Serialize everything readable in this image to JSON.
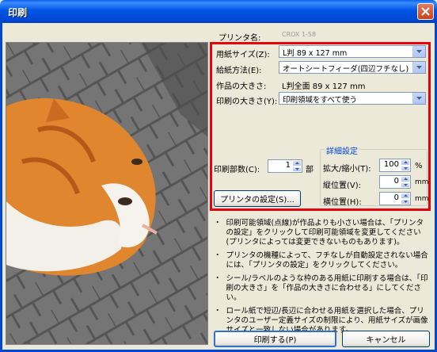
{
  "window": {
    "title": "印刷"
  },
  "printer": {
    "label": "プリンタ名:",
    "value": "CROX 1-58"
  },
  "paper_size": {
    "label": "用紙サイズ(Z):",
    "value": "L判 89 x 127 mm"
  },
  "feed_method": {
    "label": "給紙方法(E):",
    "value": "オートシートフィーダ(四辺フチなし)"
  },
  "work_size": {
    "label": "作品の大きさ:",
    "value": "L判全面 89 x 127 mm"
  },
  "print_size": {
    "label": "印刷の大きさ(Y):",
    "value": "印刷領域をすべて使う"
  },
  "copies": {
    "label": "印刷部数(C):",
    "value": "1",
    "unit": "部"
  },
  "details": {
    "group_label": "詳細設定",
    "scale_label": "拡大/縮小(T):",
    "scale_value": "100",
    "scale_unit": "%",
    "vpos_label": "縦位置(V):",
    "vpos_value": "0",
    "vpos_unit": "mm",
    "hpos_label": "横位置(H):",
    "hpos_value": "0",
    "hpos_unit": "mm"
  },
  "printer_settings_button": "プリンタの設定(S)...",
  "notes": [
    "印刷可能領域(点線)が作品よりも小さい場合は、「プリンタの設定」をクリックして印刷可能領域を変更してください(プリンタによっては変更できないものもあります)。",
    "プリンタの機種によって、フチなしが自動設定されない場合には、「プリンタの設定」をクリックしてください。",
    "シール/ラベルのような枠のある用紙に印刷する場合は、「印刷の大きさ」を「作品の大きさに合わせる」にしてください。",
    "ロール紙で短辺/長辺に合わせる用紙を選択した場合、プリンタのユーザー定義サイズの制限により、用紙サイズが画像サイズと一致しない場合があります。"
  ],
  "buttons": {
    "print": "印刷する(P)",
    "cancel": "キャンセル"
  },
  "colors": {
    "titlebar": "#0055E5",
    "highlight": "#E8000B",
    "face": "#ECE9D8"
  }
}
